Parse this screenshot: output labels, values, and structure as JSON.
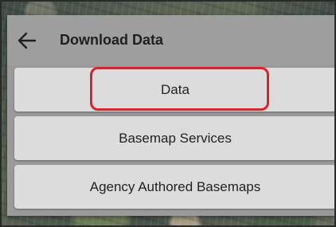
{
  "header": {
    "title": "Download Data",
    "back_icon": "arrow-left-icon"
  },
  "options": [
    {
      "label": "Data",
      "highlighted": true
    },
    {
      "label": "Basemap Services",
      "highlighted": false
    },
    {
      "label": "Agency Authored Basemaps",
      "highlighted": false
    }
  ],
  "colors": {
    "highlight": "#e0202a",
    "header_bg": "#9e9e9e",
    "option_bg": "#dcdcdc"
  }
}
